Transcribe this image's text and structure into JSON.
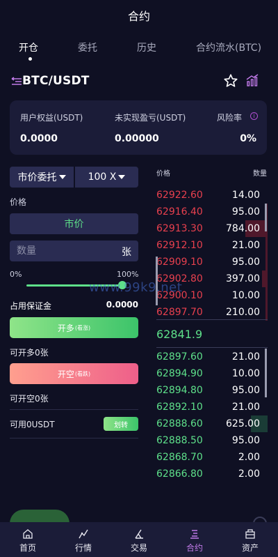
{
  "header": {
    "title": "合约"
  },
  "tabs": [
    {
      "label": "开仓",
      "active": true
    },
    {
      "label": "委托",
      "active": false
    },
    {
      "label": "历史",
      "active": false
    },
    {
      "label": "合约流水(BTC)",
      "active": false
    }
  ],
  "pair": {
    "name": "BTC/USDT",
    "icons": [
      "menu-arrows-icon",
      "star-icon",
      "chart-bars-icon"
    ]
  },
  "equity": {
    "user_equity_label": "用户权益(USDT)",
    "user_equity_value": "0.0000",
    "unrealized_label": "未实现盈亏(USDT)",
    "unrealized_value": "0.00000",
    "risk_label": "风险率",
    "risk_value": "0%"
  },
  "order_form": {
    "order_type": "市价委托",
    "leverage": "100 X",
    "price_label": "价格",
    "market_label": "市价",
    "quantity_placeholder": "数量",
    "quantity_unit": "张",
    "percent_min": "0%",
    "percent_max": "100%",
    "slider_fraction": 1.0,
    "margin_label": "占用保证金",
    "margin_value": "0.0000",
    "long_label": "开多",
    "long_sub": "(看涨)",
    "can_long": "可开多0张",
    "short_label": "开空",
    "short_sub": "(看跌)",
    "can_short": "可开空0张",
    "available": "可用0USDT",
    "transfer_label": "划转"
  },
  "orderbook": {
    "price_header": "价格",
    "qty_header": "数量",
    "asks": [
      {
        "price": "62922.60",
        "qty": "14.00",
        "depth": 0.0
      },
      {
        "price": "62916.40",
        "qty": "95.00",
        "depth": 0.02
      },
      {
        "price": "62913.30",
        "qty": "784.00",
        "depth": 0.2
      },
      {
        "price": "62912.10",
        "qty": "21.00",
        "depth": 0.02
      },
      {
        "price": "62909.10",
        "qty": "95.00",
        "depth": 0.02
      },
      {
        "price": "62902.80",
        "qty": "397.00",
        "depth": 0.05
      },
      {
        "price": "62900.10",
        "qty": "10.00",
        "depth": 0.02
      },
      {
        "price": "62897.70",
        "qty": "210.00",
        "depth": 0.02
      }
    ],
    "last_price": "62841.9",
    "bids": [
      {
        "price": "62897.60",
        "qty": "21.00",
        "depth": 0.0
      },
      {
        "price": "62894.90",
        "qty": "10.00",
        "depth": 0.0
      },
      {
        "price": "62894.80",
        "qty": "95.00",
        "depth": 0.0
      },
      {
        "price": "62892.10",
        "qty": "21.00",
        "depth": 0.0
      },
      {
        "price": "62888.60",
        "qty": "625.00",
        "depth": 0.15
      },
      {
        "price": "62888.50",
        "qty": "95.00",
        "depth": 0.0
      },
      {
        "price": "62868.70",
        "qty": "2.00",
        "depth": 0.0
      },
      {
        "price": "62866.80",
        "qty": "2.00",
        "depth": 0.0
      }
    ]
  },
  "watermark": "www.99k9.net",
  "bottom_nav": [
    {
      "label": "首页",
      "icon": "home-icon",
      "active": false
    },
    {
      "label": "行情",
      "icon": "market-icon",
      "active": false
    },
    {
      "label": "交易",
      "icon": "trade-icon",
      "active": false
    },
    {
      "label": "合约",
      "icon": "contract-icon",
      "active": true
    },
    {
      "label": "资产",
      "icon": "assets-icon",
      "active": false
    }
  ],
  "colors": {
    "bg": "#0f1023",
    "card": "#1b1c38",
    "up": "#5ee08a",
    "down": "#e8404e",
    "accent": "#c07ae8"
  }
}
